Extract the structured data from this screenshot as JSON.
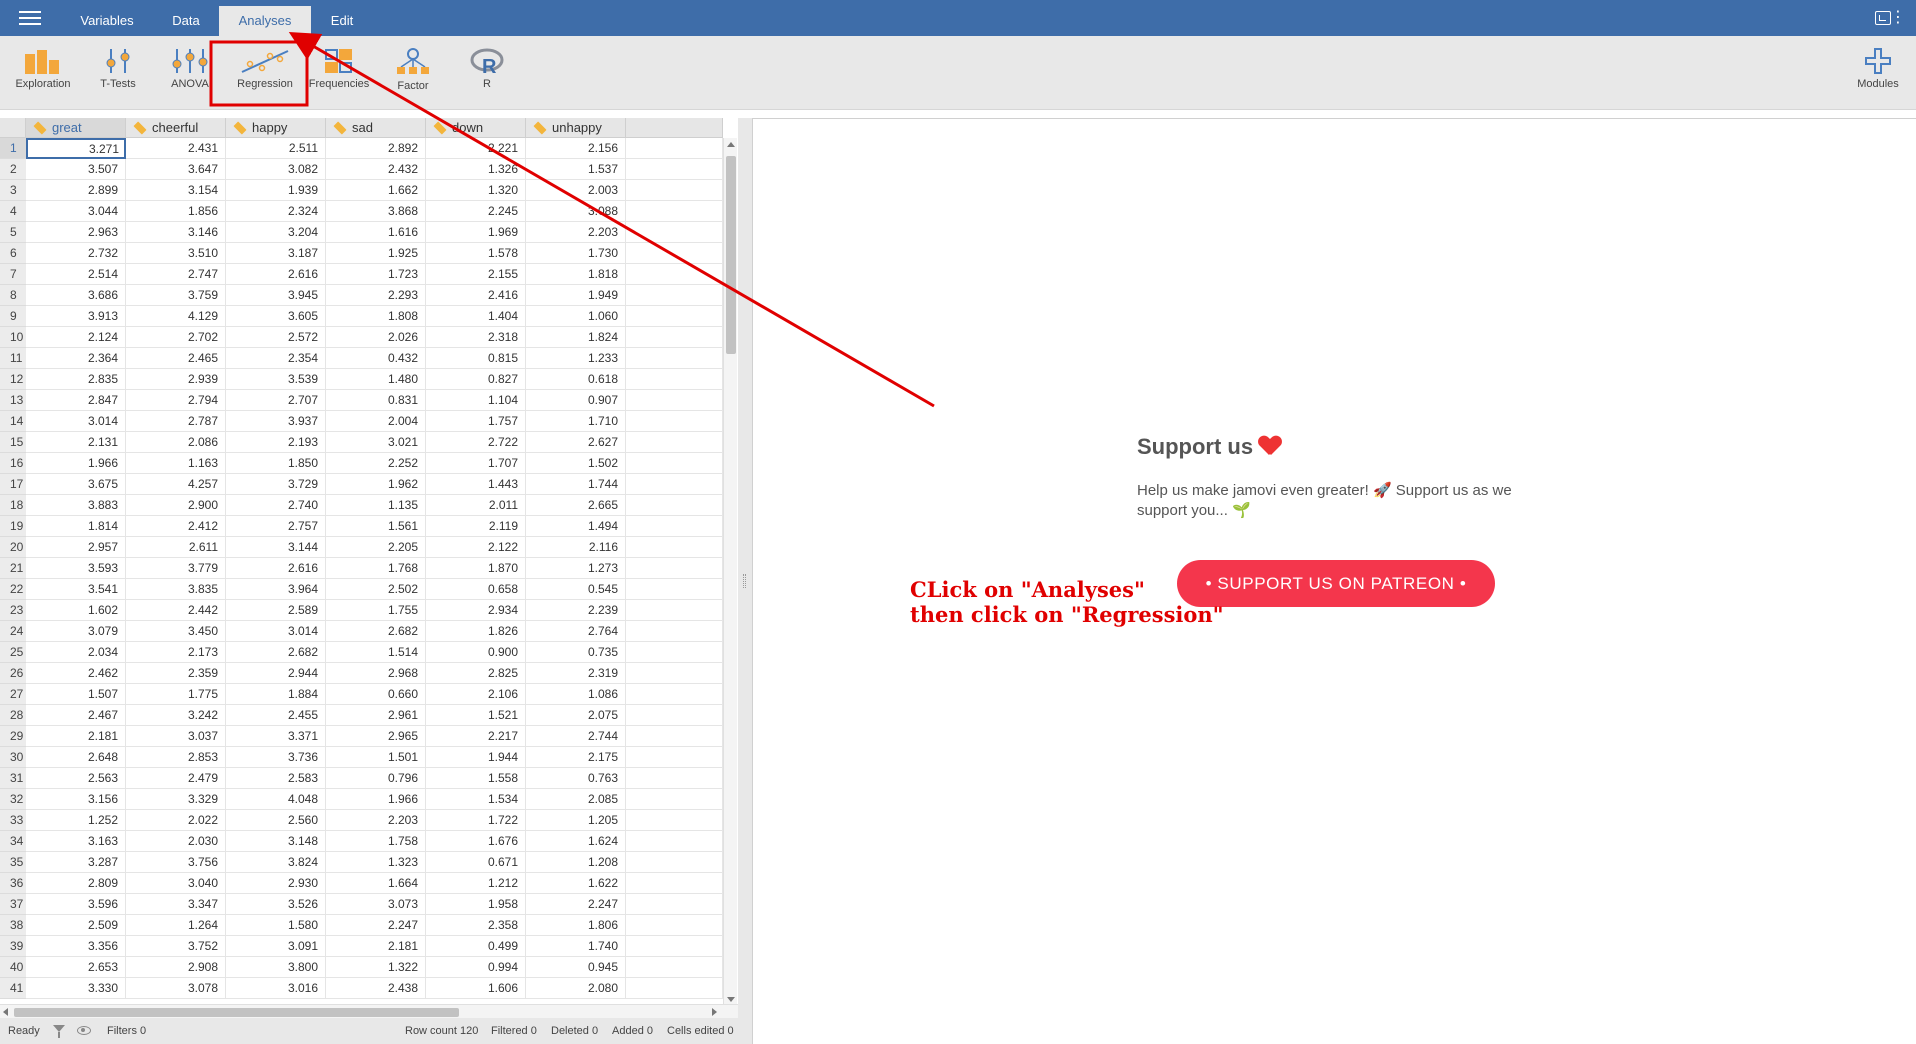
{
  "header": {
    "tabs": [
      {
        "label": "Variables",
        "active": false
      },
      {
        "label": "Data",
        "active": false
      },
      {
        "label": "Analyses",
        "active": true
      },
      {
        "label": "Edit",
        "active": false
      }
    ]
  },
  "ribbon": {
    "buttons": [
      {
        "label": "Exploration",
        "icon": "exploration-icon"
      },
      {
        "label": "T-Tests",
        "icon": "t-tests-icon"
      },
      {
        "label": "ANOVA",
        "icon": "anova-icon"
      },
      {
        "label": "Regression",
        "icon": "regression-icon"
      },
      {
        "label": "Frequencies",
        "icon": "frequencies-icon"
      },
      {
        "label": "Factor",
        "icon": "factor-icon"
      },
      {
        "label": "R",
        "icon": "r-icon"
      }
    ],
    "modules_label": "Modules"
  },
  "spreadsheet": {
    "columns": [
      "great",
      "cheerful",
      "happy",
      "sad",
      "down",
      "unhappy"
    ],
    "rows": [
      [
        "3.271",
        "2.431",
        "2.511",
        "2.892",
        "2.221",
        "2.156"
      ],
      [
        "3.507",
        "3.647",
        "3.082",
        "2.432",
        "1.326",
        "1.537"
      ],
      [
        "2.899",
        "3.154",
        "1.939",
        "1.662",
        "1.320",
        "2.003"
      ],
      [
        "3.044",
        "1.856",
        "2.324",
        "3.868",
        "2.245",
        "3.088"
      ],
      [
        "2.963",
        "3.146",
        "3.204",
        "1.616",
        "1.969",
        "2.203"
      ],
      [
        "2.732",
        "3.510",
        "3.187",
        "1.925",
        "1.578",
        "1.730"
      ],
      [
        "2.514",
        "2.747",
        "2.616",
        "1.723",
        "2.155",
        "1.818"
      ],
      [
        "3.686",
        "3.759",
        "3.945",
        "2.293",
        "2.416",
        "1.949"
      ],
      [
        "3.913",
        "4.129",
        "3.605",
        "1.808",
        "1.404",
        "1.060"
      ],
      [
        "2.124",
        "2.702",
        "2.572",
        "2.026",
        "2.318",
        "1.824"
      ],
      [
        "2.364",
        "2.465",
        "2.354",
        "0.432",
        "0.815",
        "1.233"
      ],
      [
        "2.835",
        "2.939",
        "3.539",
        "1.480",
        "0.827",
        "0.618"
      ],
      [
        "2.847",
        "2.794",
        "2.707",
        "0.831",
        "1.104",
        "0.907"
      ],
      [
        "3.014",
        "2.787",
        "3.937",
        "2.004",
        "1.757",
        "1.710"
      ],
      [
        "2.131",
        "2.086",
        "2.193",
        "3.021",
        "2.722",
        "2.627"
      ],
      [
        "1.966",
        "1.163",
        "1.850",
        "2.252",
        "1.707",
        "1.502"
      ],
      [
        "3.675",
        "4.257",
        "3.729",
        "1.962",
        "1.443",
        "1.744"
      ],
      [
        "3.883",
        "2.900",
        "2.740",
        "1.135",
        "2.011",
        "2.665"
      ],
      [
        "1.814",
        "2.412",
        "2.757",
        "1.561",
        "2.119",
        "1.494"
      ],
      [
        "2.957",
        "2.611",
        "3.144",
        "2.205",
        "2.122",
        "2.116"
      ],
      [
        "3.593",
        "3.779",
        "2.616",
        "1.768",
        "1.870",
        "1.273"
      ],
      [
        "3.541",
        "3.835",
        "3.964",
        "2.502",
        "0.658",
        "0.545"
      ],
      [
        "1.602",
        "2.442",
        "2.589",
        "1.755",
        "2.934",
        "2.239"
      ],
      [
        "3.079",
        "3.450",
        "3.014",
        "2.682",
        "1.826",
        "2.764"
      ],
      [
        "2.034",
        "2.173",
        "2.682",
        "1.514",
        "0.900",
        "0.735"
      ],
      [
        "2.462",
        "2.359",
        "2.944",
        "2.968",
        "2.825",
        "2.319"
      ],
      [
        "1.507",
        "1.775",
        "1.884",
        "0.660",
        "2.106",
        "1.086"
      ],
      [
        "2.467",
        "3.242",
        "2.455",
        "2.961",
        "1.521",
        "2.075"
      ],
      [
        "2.181",
        "3.037",
        "3.371",
        "2.965",
        "2.217",
        "2.744"
      ],
      [
        "2.648",
        "2.853",
        "3.736",
        "1.501",
        "1.944",
        "2.175"
      ],
      [
        "2.563",
        "2.479",
        "2.583",
        "0.796",
        "1.558",
        "0.763"
      ],
      [
        "3.156",
        "3.329",
        "4.048",
        "1.966",
        "1.534",
        "2.085"
      ],
      [
        "1.252",
        "2.022",
        "2.560",
        "2.203",
        "1.722",
        "1.205"
      ],
      [
        "3.163",
        "2.030",
        "3.148",
        "1.758",
        "1.676",
        "1.624"
      ],
      [
        "3.287",
        "3.756",
        "3.824",
        "1.323",
        "0.671",
        "1.208"
      ],
      [
        "2.809",
        "3.040",
        "2.930",
        "1.664",
        "1.212",
        "1.622"
      ],
      [
        "3.596",
        "3.347",
        "3.526",
        "3.073",
        "1.958",
        "2.247"
      ],
      [
        "2.509",
        "1.264",
        "1.580",
        "2.247",
        "2.358",
        "1.806"
      ],
      [
        "3.356",
        "3.752",
        "3.091",
        "2.181",
        "0.499",
        "1.740"
      ],
      [
        "2.653",
        "2.908",
        "3.800",
        "1.322",
        "0.994",
        "0.945"
      ],
      [
        "3.330",
        "3.078",
        "3.016",
        "2.438",
        "1.606",
        "2.080"
      ]
    ]
  },
  "results": {
    "support_title": "Support us",
    "support_text_1": "Help us make jamovi even greater! 🚀 Support us as we",
    "support_text_2": "support you... 🌱",
    "patreon_label": "•  SUPPORT US ON PATREON  •"
  },
  "annotation": {
    "text": "CLick on \"Analyses\"\nthen click on \"Regression\""
  },
  "status": {
    "ready": "Ready",
    "filters": "Filters 0",
    "row_count": "Row count 120",
    "filtered": "Filtered 0",
    "deleted": "Deleted 0",
    "added": "Added 0",
    "cells_edited": "Cells edited 0"
  },
  "colors": {
    "header_blue": "#3e6da9",
    "patreon_red": "#f4364c",
    "annotation_red": "#e00000"
  }
}
